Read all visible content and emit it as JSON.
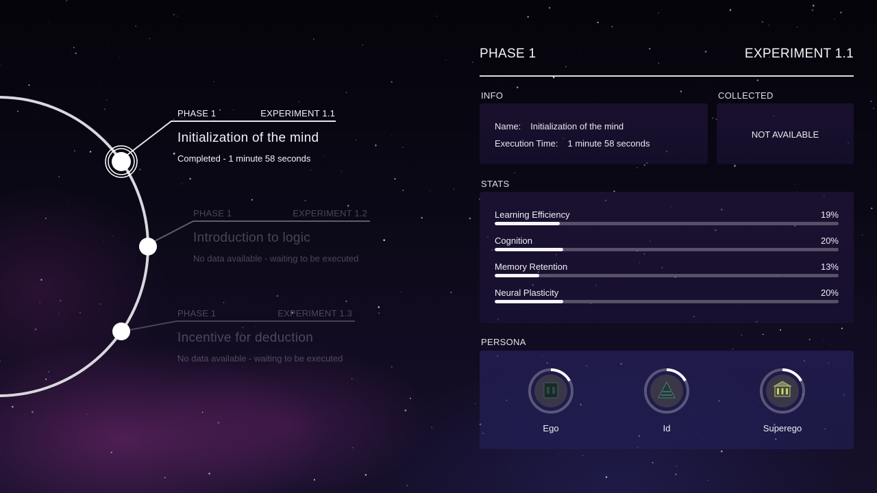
{
  "colors": {
    "accent": "#f4f4f8",
    "dim_text": "#5a5868",
    "orbit": "#d8d8de",
    "panel_bg": "#1e1436"
  },
  "timeline": [
    {
      "phase": "PHASE 1",
      "experiment": "EXPERIMENT 1.1",
      "title": "Initialization of the mind",
      "status": "Completed - 1 minute 58 seconds",
      "active": true
    },
    {
      "phase": "PHASE 1",
      "experiment": "EXPERIMENT 1.2",
      "title": "Introduction to logic",
      "status": "No data available - waiting to be executed",
      "active": false
    },
    {
      "phase": "PHASE 1",
      "experiment": "EXPERIMENT 1.3",
      "title": "Incentive for deduction",
      "status": "No data available - waiting to be executed",
      "active": false
    }
  ],
  "panel": {
    "phase": "PHASE 1",
    "experiment": "EXPERIMENT 1.1",
    "info_label": "INFO",
    "collected_label": "COLLECTED",
    "name_key": "Name:",
    "name_value": "Initialization of the mind",
    "time_key": "Execution Time:",
    "time_value": "1 minute 58 seconds",
    "collected_value": "NOT AVAILABLE",
    "stats_label": "STATS",
    "persona_label": "PERSONA"
  },
  "stats": [
    {
      "label": "Learning Efficiency",
      "value_text": "19%",
      "value": 19
    },
    {
      "label": "Cognition",
      "value_text": "20%",
      "value": 20
    },
    {
      "label": "Memory Retention",
      "value_text": "13%",
      "value": 13
    },
    {
      "label": "Neural Plasticity",
      "value_text": "20%",
      "value": 20
    }
  ],
  "personas": [
    {
      "label": "Ego",
      "progress": 0.17,
      "icon": "dark-cabinet-icon"
    },
    {
      "label": "Id",
      "progress": 0.17,
      "icon": "pyramid-icon"
    },
    {
      "label": "Superego",
      "progress": 0.17,
      "icon": "ornate-building-icon"
    }
  ]
}
